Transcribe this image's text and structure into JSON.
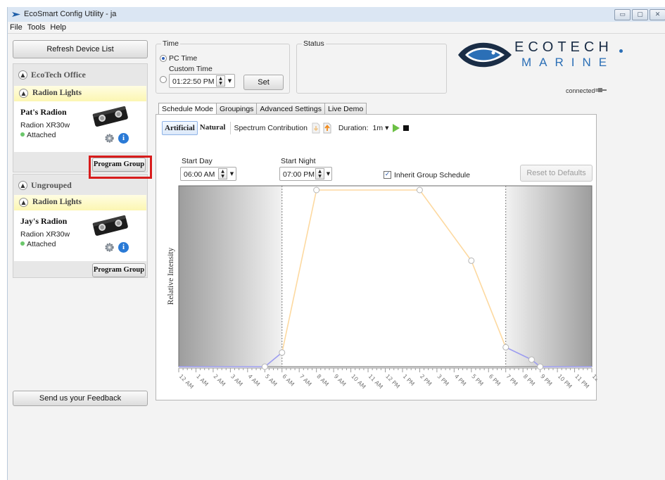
{
  "window": {
    "title": "EcoSmart Config Utility - ja"
  },
  "menu": [
    "File",
    "Tools",
    "Help"
  ],
  "sidebar": {
    "refresh_label": "Refresh Device List",
    "feedback_label": "Send us your Feedback",
    "groups": [
      {
        "name": "EcoTech Office",
        "subgroup": "Radion Lights",
        "device": {
          "name": "Pat's Radion",
          "model": "Radion XR30w",
          "status": "Attached"
        },
        "program_label": "Program Group"
      },
      {
        "name": "Ungrouped",
        "subgroup": "Radion Lights",
        "device": {
          "name": "Jay's Radion",
          "model": "Radion XR30w",
          "status": "Attached"
        },
        "program_label": "Program Group"
      }
    ]
  },
  "time": {
    "title": "Time",
    "pc_time": "PC Time",
    "custom_time": "Custom Time",
    "value": "01:22:50 PM",
    "set_label": "Set",
    "selected": "PC Time"
  },
  "status": {
    "title": "Status"
  },
  "logo": {
    "line1": "ECOTECH",
    "line2": "MARINE"
  },
  "connection": {
    "text": "connected"
  },
  "tabs": [
    "Schedule Mode",
    "Groupings",
    "Advanced Settings",
    "Live Demo"
  ],
  "active_tab": "Schedule Mode",
  "schedule": {
    "modes": [
      "Artificial",
      "Natural"
    ],
    "selected_mode": "Artificial",
    "spectrum_label": "Spectrum Contribution",
    "duration_label": "Duration:",
    "duration_value": "1m",
    "start_day_label": "Start Day",
    "start_day": "06:00 AM",
    "start_night_label": "Start Night",
    "start_night": "07:00 PM",
    "inherit_label": "Inherit Group Schedule",
    "inherit_checked": true,
    "reset_label": "Reset to Defaults"
  },
  "colors": {
    "accent": "#2b6fb6",
    "day_curve": "#fdd9a0",
    "night_curve": "#9c9cf0",
    "highlight": "#d81c1c"
  },
  "chart_data": {
    "type": "line",
    "ylabel": "Relative Intensity",
    "x_ticks": [
      "12 AM",
      "1 AM",
      "2 AM",
      "3 AM",
      "4 AM",
      "5 AM",
      "6 AM",
      "7 AM",
      "8 AM",
      "9 AM",
      "10 AM",
      "11 AM",
      "12 PM",
      "1 PM",
      "2 PM",
      "3 PM",
      "4 PM",
      "5 PM",
      "6 PM",
      "7 PM",
      "8 PM",
      "9 PM",
      "10 PM",
      "11 PM",
      "12 AM"
    ],
    "xlim": [
      0,
      24
    ],
    "ylim": [
      0,
      100
    ],
    "day_start_hour": 6,
    "night_start_hour": 19,
    "series": [
      {
        "x": [
          0,
          5,
          6
        ],
        "y": [
          0,
          0,
          8
        ]
      },
      {
        "x": [
          6,
          8,
          14,
          17,
          19
        ],
        "y": [
          8,
          100,
          100,
          60,
          11
        ]
      },
      {
        "x": [
          19,
          20.5,
          21,
          24
        ],
        "y": [
          11,
          4,
          0,
          0
        ]
      }
    ],
    "control_points": [
      {
        "x": 5,
        "y": 0
      },
      {
        "x": 6,
        "y": 8
      },
      {
        "x": 8,
        "y": 100
      },
      {
        "x": 14,
        "y": 100
      },
      {
        "x": 17,
        "y": 60
      },
      {
        "x": 19,
        "y": 11
      },
      {
        "x": 20.5,
        "y": 4
      },
      {
        "x": 21,
        "y": 0
      }
    ]
  }
}
